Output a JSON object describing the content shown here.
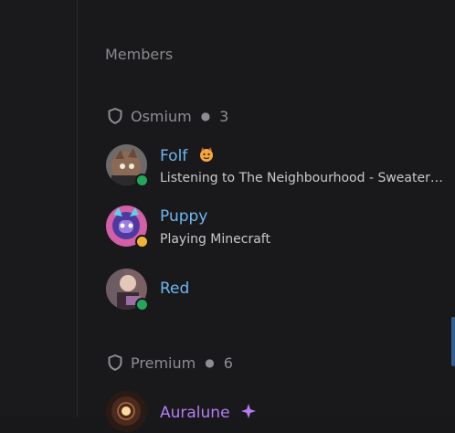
{
  "section_title": "Members",
  "groups": [
    {
      "name": "Osmium",
      "count": "3"
    },
    {
      "name": "Premium",
      "count": "6"
    }
  ],
  "members": [
    {
      "name": "Folf",
      "activity": "Listening to The Neighbourhood - Sweater Weather",
      "status": "online",
      "status_color": "#23a55a",
      "name_badge": "devil-cat-emoji"
    },
    {
      "name": "Puppy",
      "activity": "Playing Minecraft",
      "status": "idle",
      "status_color": "#f0b232"
    },
    {
      "name": "Red",
      "activity": "",
      "status": "online",
      "status_color": "#23a55a"
    },
    {
      "name": "Auralune",
      "activity": "",
      "status": "unknown",
      "name_color": "#b47cf5",
      "name_badge": "sparkle-icon"
    }
  ],
  "colors": {
    "name_blue": "#6fb6f0",
    "name_purple": "#b47cf5",
    "muted_text": "#8d8d93",
    "background": "#19191b",
    "scroll_accent": "#2f5f93"
  }
}
